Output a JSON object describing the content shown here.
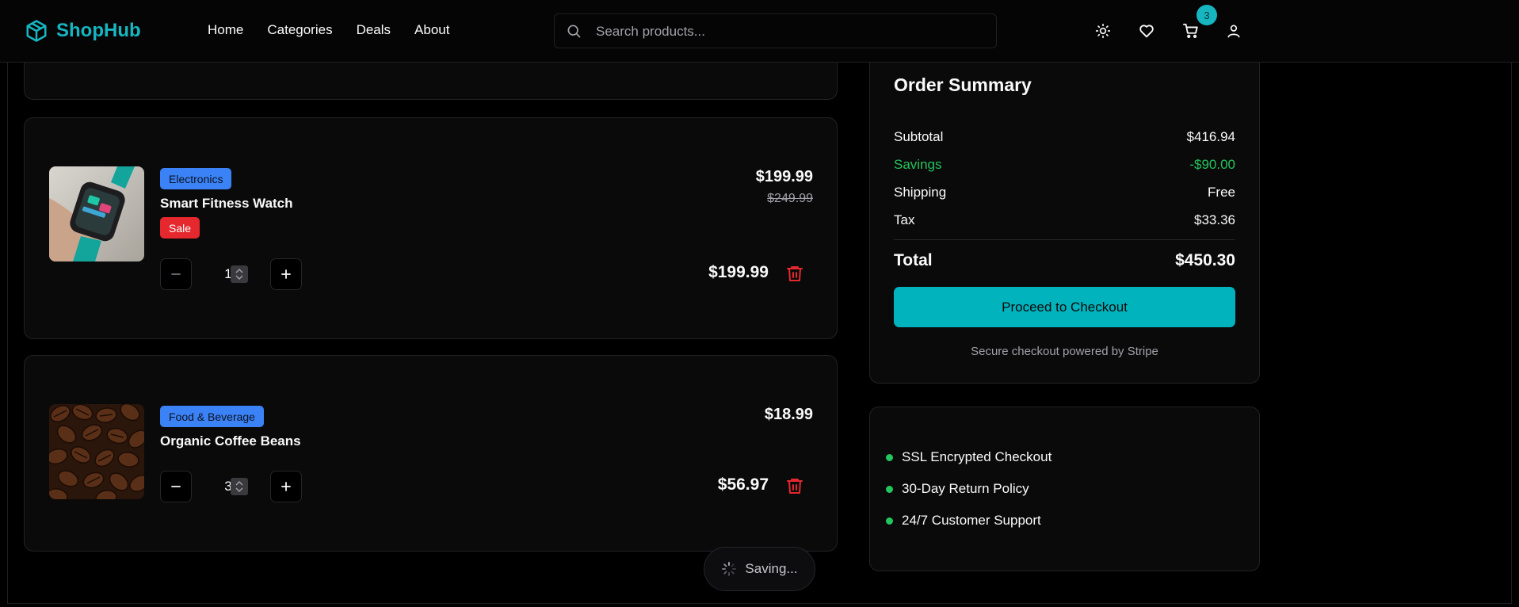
{
  "header": {
    "brand": "ShopHub",
    "nav": [
      "Home",
      "Categories",
      "Deals",
      "About"
    ],
    "search_placeholder": "Search products...",
    "cart_count": "3"
  },
  "cart": {
    "items": [
      {
        "category": "Electronics",
        "name": "Smart Fitness Watch",
        "sale_label": "Sale",
        "quantity": "1",
        "price": "$199.99",
        "old_price": "$249.99",
        "line_total": "$199.99"
      },
      {
        "category": "Food & Beverage",
        "name": "Organic Coffee Beans",
        "quantity": "3",
        "price": "$18.99",
        "line_total": "$56.97"
      }
    ]
  },
  "summary": {
    "title": "Order Summary",
    "subtotal_label": "Subtotal",
    "subtotal": "$416.94",
    "savings_label": "Savings",
    "savings": "-$90.00",
    "shipping_label": "Shipping",
    "shipping": "Free",
    "tax_label": "Tax",
    "tax": "$33.36",
    "total_label": "Total",
    "total": "$450.30",
    "checkout_label": "Proceed to Checkout",
    "secure_note": "Secure checkout powered by Stripe"
  },
  "trust": [
    "SSL Encrypted Checkout",
    "30-Day Return Policy",
    "24/7 Customer Support"
  ],
  "status": {
    "saving": "Saving..."
  },
  "colors": {
    "accent": "#16b5c0",
    "savings": "#22c55e",
    "danger": "#e5282d",
    "category": "#3b82f6"
  }
}
